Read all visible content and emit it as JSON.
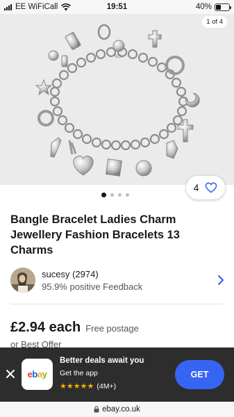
{
  "status_bar": {
    "carrier": "EE WiFiCall",
    "time": "19:51",
    "battery_percent": "40%",
    "battery_level": 0.4
  },
  "gallery": {
    "counter": "1 of 4",
    "pages": 4,
    "active_page": 1
  },
  "watch": {
    "count": "4"
  },
  "listing": {
    "title": "Bangle Bracelet Ladies Charm Jewellery Fashion Bracelets   13 Charms"
  },
  "seller": {
    "name": "sucesy (2974)",
    "feedback": "95.9% positive Feedback"
  },
  "pricing": {
    "price": "£2.94 each",
    "postage": "Free postage",
    "best_offer": "or Best Offer"
  },
  "app_banner": {
    "title": "Better deals await you",
    "subtitle": "Get the app",
    "rating_count": "(4M+)",
    "stars": 5,
    "cta": "GET",
    "logo_text": "ebay"
  },
  "url_bar": {
    "domain": "ebay.co.uk"
  },
  "colors": {
    "accent_blue": "#3665f3",
    "star_yellow": "#f5af02",
    "banner_bg": "#2d2d2d"
  }
}
